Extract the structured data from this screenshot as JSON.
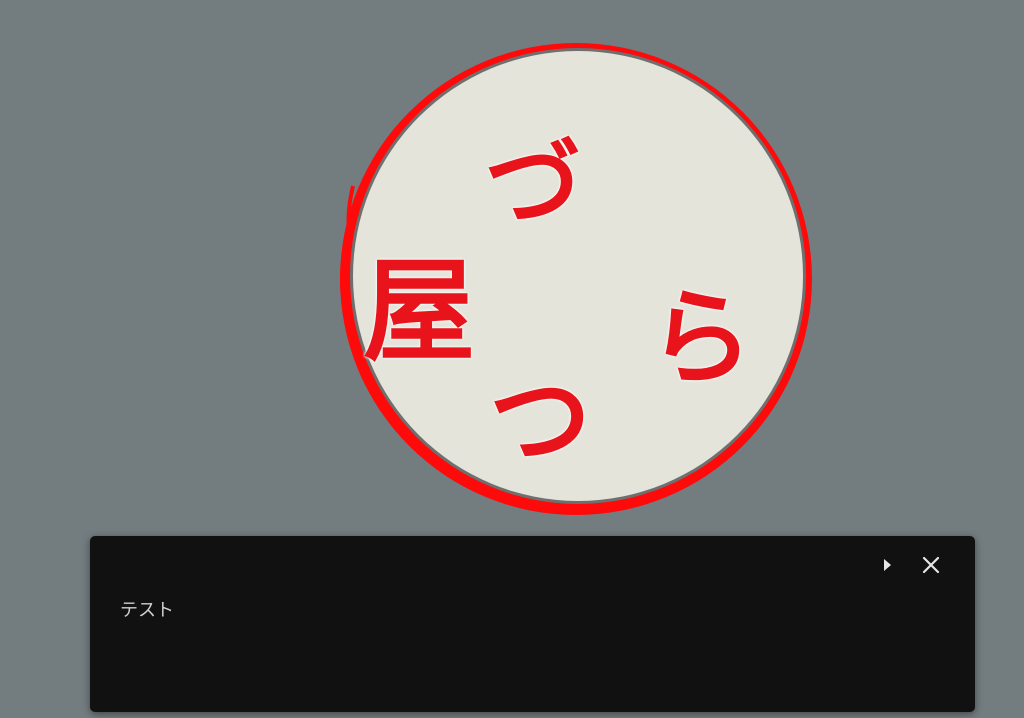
{
  "seal": {
    "char_top": "づ",
    "char_left": "屋",
    "char_right": "ら",
    "char_bottom": "つ",
    "ring_color": "#ff0a0a",
    "fill_color": "#e4e4da",
    "text_color": "#e8131b"
  },
  "panel": {
    "text": "テスト",
    "background": "#111111",
    "icons": {
      "expand": "play-arrow-icon",
      "close": "close-icon"
    }
  }
}
